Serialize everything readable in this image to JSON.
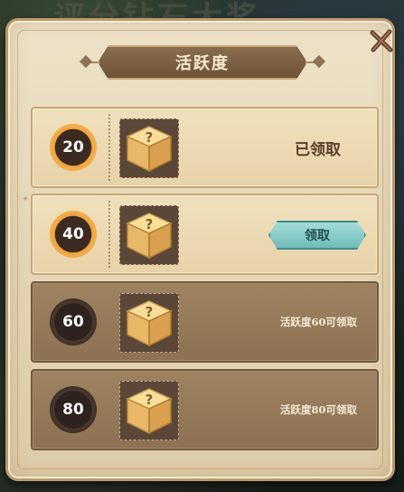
{
  "background": {
    "title_fragment": "评分钻石大奖"
  },
  "dialog": {
    "title": "活跃度",
    "close_icon": "close-x-icon"
  },
  "rows": [
    {
      "threshold": "20",
      "reward_icon": "mystery-box-icon",
      "status": "claimed",
      "status_text": "已领取"
    },
    {
      "threshold": "40",
      "reward_icon": "mystery-box-icon",
      "status": "claimable",
      "button_label": "领取"
    },
    {
      "threshold": "60",
      "reward_icon": "mystery-box-icon",
      "status": "locked",
      "status_text": "活跃度60可领取"
    },
    {
      "threshold": "80",
      "reward_icon": "mystery-box-icon",
      "status": "locked",
      "status_text": "活跃度80可领取"
    }
  ],
  "colors": {
    "parchment": "#e8d8b5",
    "badge_gold": "#f0a33b",
    "claim_button": "#8fd0cc",
    "dark_row": "#947758"
  }
}
